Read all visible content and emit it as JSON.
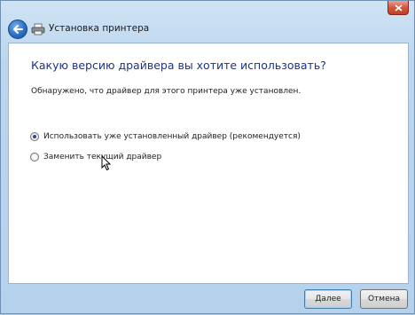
{
  "window": {
    "title": "Установка принтера"
  },
  "main": {
    "question": "Какую версию драйвера вы хотите использовать?",
    "info": "Обнаружено, что драйвер для этого принтера уже установлен.",
    "options": [
      {
        "label": "Использовать уже установленный драйвер (рекомендуется)",
        "selected": true
      },
      {
        "label": "Заменить текущий драйвер",
        "selected": false
      }
    ]
  },
  "footer": {
    "next_label": "Далее",
    "cancel_label": "Отмена"
  },
  "icons": {
    "close": "close-icon",
    "back": "back-arrow-icon",
    "printer": "printer-icon"
  }
}
